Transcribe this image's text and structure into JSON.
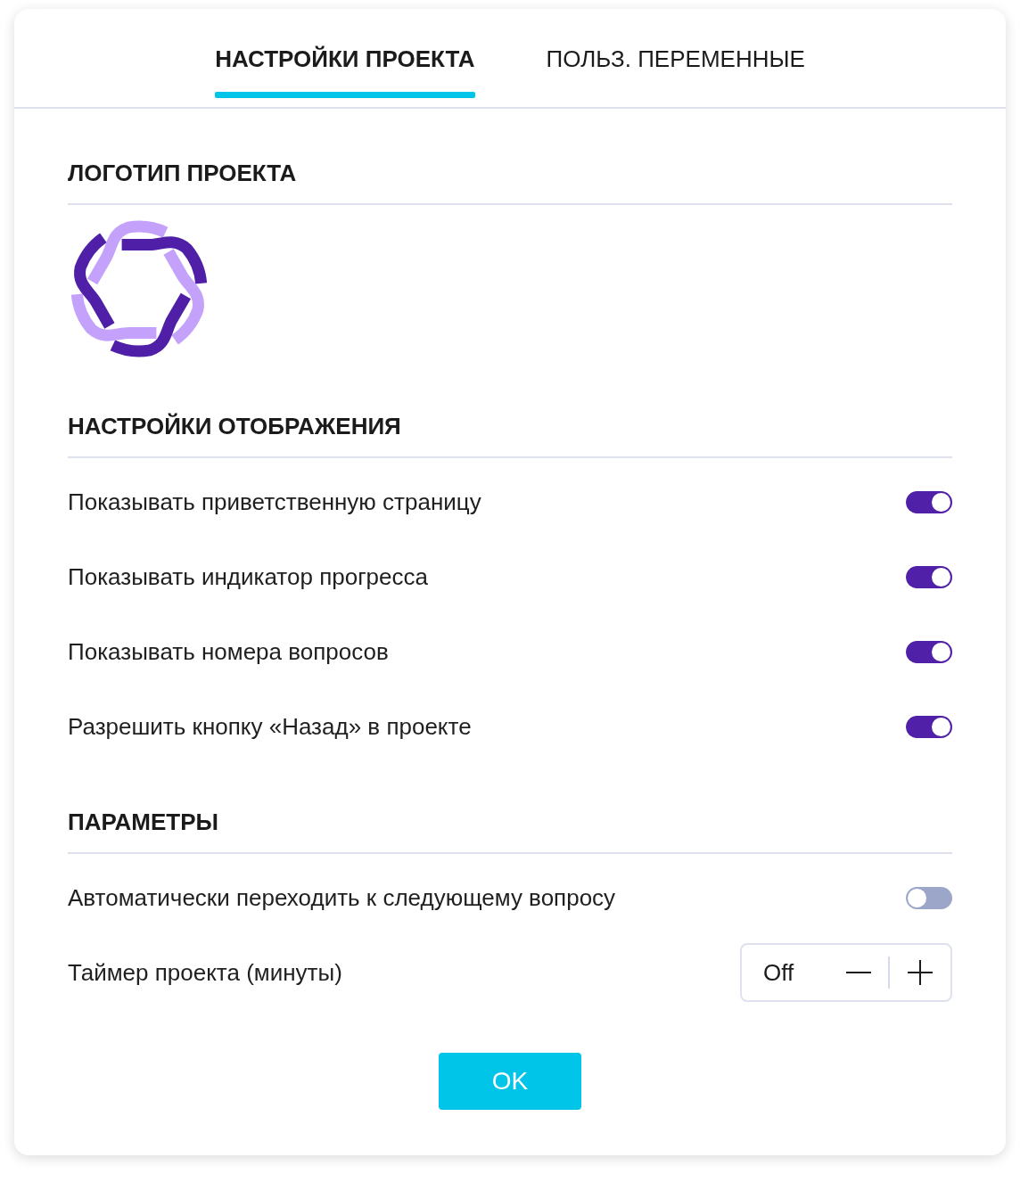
{
  "tabs": [
    {
      "label": "НАСТРОЙКИ ПРОЕКТА",
      "selected": true
    },
    {
      "label": "ПОЛЬЗ. ПЕРЕМЕННЫЕ",
      "selected": false
    }
  ],
  "logo_section": {
    "title": "ЛОГОТИП ПРОЕКТА"
  },
  "display_section": {
    "title": "НАСТРОЙКИ ОТОБРАЖЕНИЯ",
    "options": [
      {
        "label": "Показывать приветственную страницу",
        "on": true
      },
      {
        "label": "Показывать индикатор прогресса",
        "on": true
      },
      {
        "label": "Показывать номера вопросов",
        "on": true
      },
      {
        "label": "Разрешить кнопку «Назад» в проекте",
        "on": true
      }
    ]
  },
  "parameters_section": {
    "title": "ПАРАМЕТРЫ",
    "options": [
      {
        "kind": "toggle",
        "label": "Автоматически переходить к следующему вопросу",
        "on": false
      },
      {
        "kind": "stepper",
        "label": "Таймер проекта (минуты)",
        "value": "Off"
      }
    ]
  },
  "buttons": [
    "OK"
  ]
}
